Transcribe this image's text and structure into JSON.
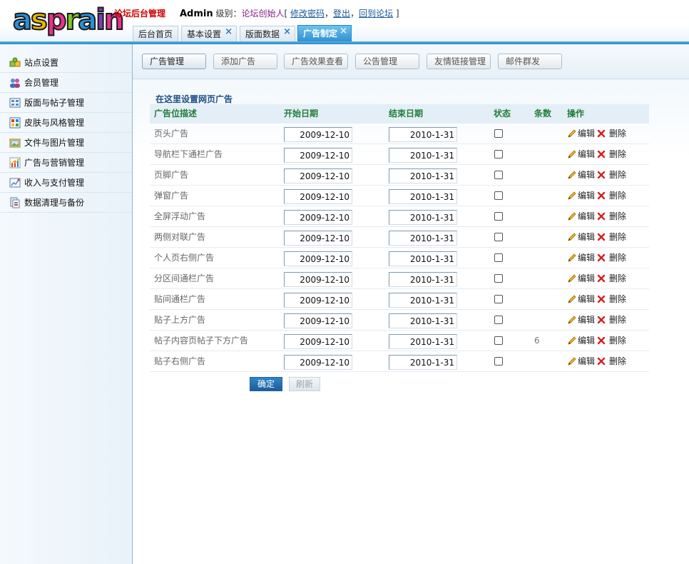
{
  "header": {
    "logo_text": "asprain",
    "logo_colors": [
      "#2b8fd6",
      "#e8b800",
      "#e8338c",
      "#7bc628",
      "#2b8fd6",
      "#7b3fb5",
      "#e8338c"
    ],
    "site_title": "论坛后台管理",
    "username": "Admin",
    "role_label": "级别：",
    "role_value": "论坛创始人",
    "bracket_open": "[",
    "bracket_close": "]",
    "link_change_password": "修改密码",
    "link_logout": "登出",
    "link_back_forum": "回到论坛",
    "comma": "，"
  },
  "top_tabs": [
    {
      "label": "后台首页",
      "closable": false
    },
    {
      "label": "基本设置",
      "closable": true
    },
    {
      "label": "版面数据",
      "closable": true
    },
    {
      "label": "广告制定",
      "closable": true,
      "active": true
    }
  ],
  "close_glyph": "×",
  "sidebar": {
    "items": [
      {
        "label": "站点设置",
        "icon": "puzzle-icon"
      },
      {
        "label": "会员管理",
        "icon": "users-icon"
      },
      {
        "label": "版面与帖子管理",
        "icon": "board-icon"
      },
      {
        "label": "皮肤与风格管理",
        "icon": "palette-icon"
      },
      {
        "label": "文件与图片管理",
        "icon": "picture-icon"
      },
      {
        "label": "广告与营销管理",
        "icon": "chart-icon"
      },
      {
        "label": "收入与支付管理",
        "icon": "payment-icon"
      },
      {
        "label": "数据清理与备份",
        "icon": "backup-icon"
      }
    ]
  },
  "sub_tabs": [
    {
      "label": "广告管理",
      "active": true
    },
    {
      "label": "添加广告"
    },
    {
      "label": "广告效果查看"
    },
    {
      "label": "公告管理"
    },
    {
      "label": "友情链接管理"
    },
    {
      "label": "邮件群发"
    }
  ],
  "section_title": "在这里设置网页广告",
  "columns": {
    "desc": "广告位描述",
    "start": "开始日期",
    "end": "结束日期",
    "status": "状态",
    "count": "条数",
    "ops": "操作"
  },
  "rows": [
    {
      "name": "页头广告",
      "start": "2009-12-10",
      "end": "2010-1-31",
      "count": ""
    },
    {
      "name": "导航栏下通栏广告",
      "start": "2009-12-10",
      "end": "2010-1-31",
      "count": ""
    },
    {
      "name": "页脚广告",
      "start": "2009-12-10",
      "end": "2010-1-31",
      "count": ""
    },
    {
      "name": "弹窗广告",
      "start": "2009-12-10",
      "end": "2010-1-31",
      "count": ""
    },
    {
      "name": "全屏浮动广告",
      "start": "2009-12-10",
      "end": "2010-1-31",
      "count": ""
    },
    {
      "name": "两侧对联广告",
      "start": "2009-12-10",
      "end": "2010-1-31",
      "count": ""
    },
    {
      "name": "个人页右侧广告",
      "start": "2009-12-10",
      "end": "2010-1-31",
      "count": ""
    },
    {
      "name": "分区间通栏广告",
      "start": "2009-12-10",
      "end": "2010-1-31",
      "count": ""
    },
    {
      "name": "贴间通栏广告",
      "start": "2009-12-10",
      "end": "2010-1-31",
      "count": ""
    },
    {
      "name": "贴子上方广告",
      "start": "2009-12-10",
      "end": "2010-1-31",
      "count": ""
    },
    {
      "name": "帖子内容页帖子下方广告",
      "start": "2009-12-10",
      "end": "2010-1-31",
      "count": "6"
    },
    {
      "name": "贴子右侧广告",
      "start": "2009-12-10",
      "end": "2010-1-31",
      "count": ""
    }
  ],
  "row_actions": {
    "edit": "编辑",
    "delete": "删除"
  },
  "buttons": {
    "confirm": "确定",
    "refresh": "刷新"
  },
  "colors": {
    "accent": "#2a86c7",
    "header_green": "#1f7d3a",
    "title_red": "#d00000",
    "delete_red": "#d42020"
  }
}
